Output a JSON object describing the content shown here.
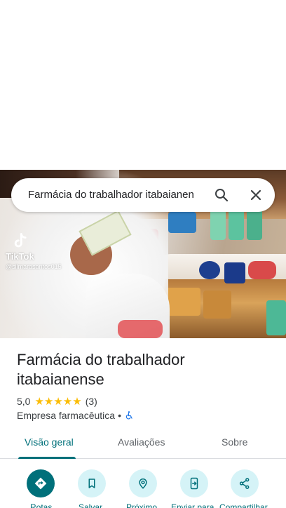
{
  "search": {
    "query": "Farmácia do trabalhador itabaianen"
  },
  "photo": {
    "watermark_brand": "TikTok",
    "watermark_user": "@silmarasantos015"
  },
  "place": {
    "title": "Farmácia do trabalhador itabaianense",
    "rating": "5,0",
    "stars": "★★★★★",
    "review_count": "(3)",
    "category": "Empresa farmacêutica",
    "separator": "•"
  },
  "tabs": [
    {
      "label": "Visão geral",
      "active": true
    },
    {
      "label": "Avaliações",
      "active": false
    },
    {
      "label": "Sobre",
      "active": false
    }
  ],
  "actions": [
    {
      "label": "Rotas",
      "icon": "directions-icon"
    },
    {
      "label": "Salvar",
      "icon": "bookmark-icon"
    },
    {
      "label": "Próximo",
      "icon": "nearby-icon"
    },
    {
      "label": "Enviar para",
      "icon": "send-to-phone-icon"
    },
    {
      "label": "Compartilhar",
      "icon": "share-icon"
    }
  ],
  "colors": {
    "accent": "#00707a",
    "action_bg": "#d5f3f7",
    "star": "#fbbc04",
    "accessibility": "#1a73e8"
  }
}
